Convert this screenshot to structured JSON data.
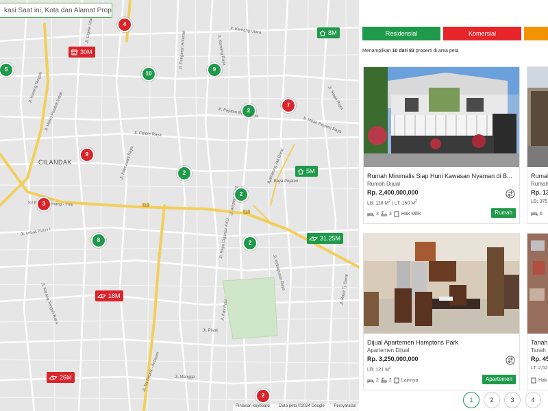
{
  "search": {
    "placeholder": "kasi Saat ini, Kota dan Alamat Properti"
  },
  "map": {
    "area_name": "CILANDAK",
    "clusters": [
      {
        "count": "4",
        "color": "red"
      },
      {
        "count": "5",
        "color": "green"
      },
      {
        "count": "10",
        "color": "green"
      },
      {
        "count": "9",
        "color": "green"
      },
      {
        "count": "2",
        "color": "green"
      },
      {
        "count": "7",
        "color": "red"
      },
      {
        "count": "9",
        "color": "red"
      },
      {
        "count": "2",
        "color": "green"
      },
      {
        "count": "2",
        "color": "green"
      },
      {
        "count": "3",
        "color": "red"
      },
      {
        "count": "8",
        "color": "green"
      },
      {
        "count": "2",
        "color": "green"
      },
      {
        "count": "2",
        "color": "red"
      }
    ],
    "price_tags": [
      {
        "label": "8M",
        "color": "green",
        "icon": "house-icon"
      },
      {
        "label": "30M",
        "color": "red",
        "icon": "shop-icon"
      },
      {
        "label": "5M",
        "color": "green",
        "icon": "house-icon"
      },
      {
        "label": "31.25M",
        "color": "green",
        "icon": "land-icon"
      },
      {
        "label": "18M",
        "color": "red",
        "icon": "land-icon"
      },
      {
        "label": "26M",
        "color": "red",
        "icon": "land-icon"
      }
    ],
    "street_labels": [
      "Jl. Kemang Utara",
      "Jl. Karang Tengah",
      "Jl. Metro Pondok Indah",
      "Jl. Pangeran Antasari",
      "Jl. Kemang Raya",
      "Jl. Cipete Raya",
      "Jl. Fatmawati Raya",
      "Jl. Pejaten Barat Raya",
      "Jl. Warung Jati Barat",
      "Jl. Ampera Raya",
      "Tol Pondok Pinang - Tmii",
      "Jl. Lebak Bulus I",
      "Jl. Raya Ciganjur KKO",
      "Jl. Kebagusan Raya",
      "Jl. Tol Depok - Antasari",
      "Jl. Karang Tengah Raya",
      "Jl. Mangga",
      "Jl. Pisok",
      "Jl. Kav Polri",
      "Jl. Raya Ragunan",
      "Jl. Ujung Aspal",
      "Jl. Mbak Pejaten Raya",
      "Jl. Siaga Raya",
      "Jl. Baya Pejaten",
      "Jl. Cipete Utara",
      "Jl. Raya Tj. Barat"
    ],
    "road_numbers": [
      "25",
      "25"
    ],
    "footer": {
      "shortcuts": "Pintasan keyboard",
      "map_data": "Data peta ©2024 Google",
      "terms": "Persyaratan"
    }
  },
  "filters": [
    {
      "label": "Residensial",
      "color": "#1e9a4a"
    },
    {
      "label": "Komersial",
      "color": "#e8242b"
    },
    {
      "label": "",
      "color": "#f39200"
    }
  ],
  "summary": {
    "prefix": "Menampilkan",
    "shown": "10 dari 83",
    "suffix": "properti di area peta"
  },
  "listings": [
    {
      "title": "Rumah Minimalis Siap Huni Kawasan Nyaman di B...",
      "type": "Rumah Dijual",
      "price": "Rp. 2,400,000,000",
      "lb": "LB: 118 M",
      "lt": "LT: 150 M",
      "beds": "3",
      "baths": "3",
      "cert": "Hak Milik",
      "badge": "Rumah"
    },
    {
      "title": "Rumah",
      "type": "Rumah",
      "price": "Rp. 13,",
      "lb": "LB: 375",
      "beds": "6",
      "baths": "",
      "cert": ""
    },
    {
      "title": "Dijual Apartemen Hamptons Park",
      "type": "Apartemen Dijual",
      "price": "Rp. 3,250,000,000",
      "lb": "LB: 121 M",
      "beds": "2",
      "baths": "2",
      "cert": "Lainnya",
      "badge": "Apartemen"
    },
    {
      "title": "Tanah",
      "type": "Tanah",
      "price": "Rp. 45,",
      "lb": "LT: 2,52",
      "cert": "Hak"
    }
  ],
  "pagination": [
    "1",
    "2",
    "3",
    "4"
  ]
}
